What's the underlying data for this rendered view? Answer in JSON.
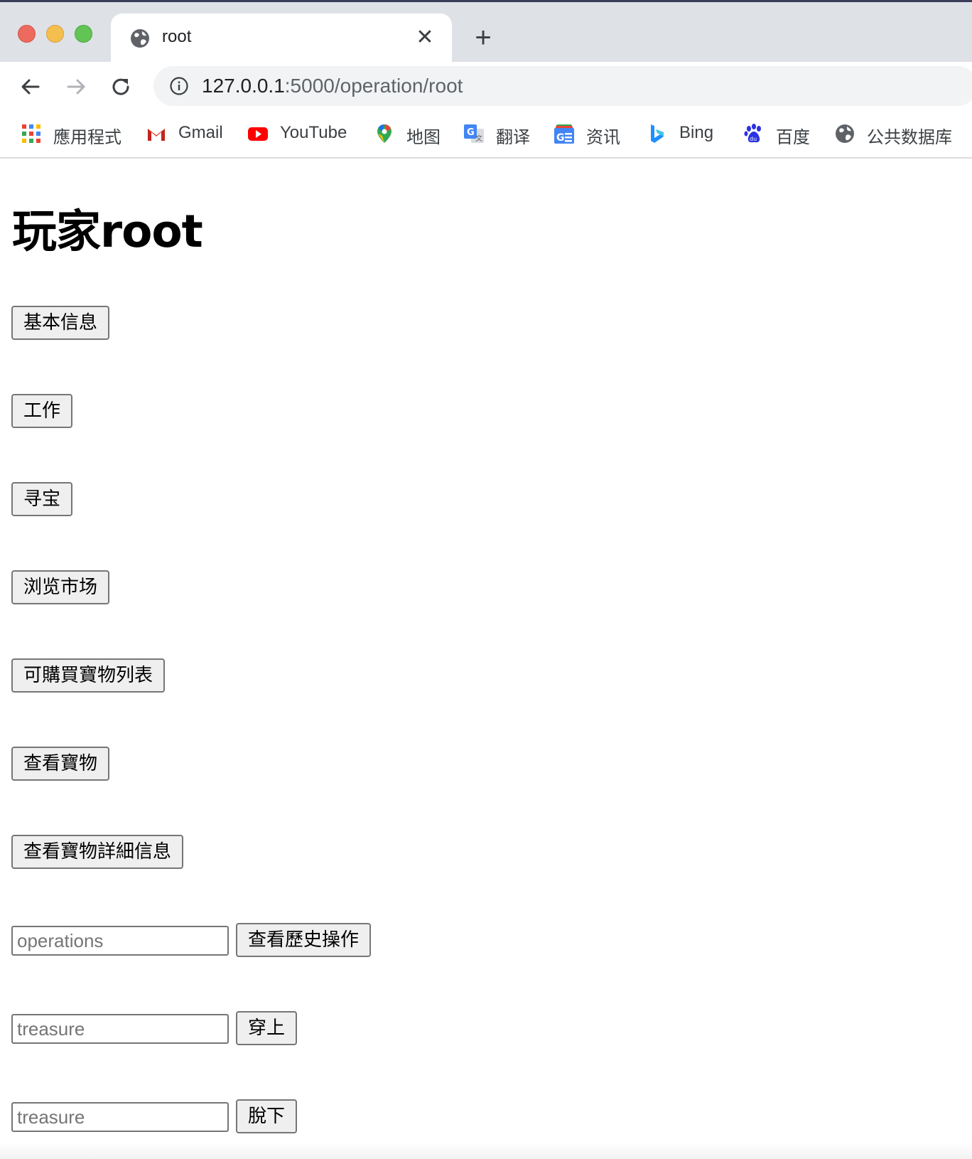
{
  "browser": {
    "tab_title": "root",
    "tab_close_glyph": "✕",
    "new_tab_glyph": "+",
    "url_host": "127.0.0.1",
    "url_path": ":5000/operation/root",
    "bookmarks": [
      {
        "label": "應用程式",
        "icon": "apps-grid-icon"
      },
      {
        "label": "Gmail",
        "icon": "gmail-icon"
      },
      {
        "label": "YouTube",
        "icon": "youtube-icon"
      },
      {
        "label": "地图",
        "icon": "maps-pin-icon"
      },
      {
        "label": "翻译",
        "icon": "translate-icon"
      },
      {
        "label": "资讯",
        "icon": "news-icon"
      },
      {
        "label": "Bing",
        "icon": "bing-icon"
      },
      {
        "label": "百度",
        "icon": "baidu-paw-icon"
      },
      {
        "label": "公共数据库",
        "icon": "globe-icon"
      }
    ]
  },
  "page": {
    "title": "玩家root",
    "buttons": {
      "basic_info": "基本信息",
      "work": "工作",
      "treasure_hunt": "寻宝",
      "browse_market": "浏览市场",
      "buyable_list": "可購買寶物列表",
      "view_treasures": "查看寶物",
      "view_treasure_details": "查看寶物詳細信息",
      "view_history": "查看歷史操作",
      "wear": "穿上",
      "take_off": "脫下"
    },
    "inputs": {
      "operations_placeholder": "operations",
      "wear_placeholder": "treasure",
      "take_off_placeholder": "treasure"
    }
  },
  "colors": {
    "tabstrip": "#dee1e6",
    "close_red": "#ed6a5e",
    "minimize_yellow": "#f5bf4f",
    "zoom_green": "#61c454",
    "button_bg": "#efefef",
    "button_border": "#767676"
  }
}
